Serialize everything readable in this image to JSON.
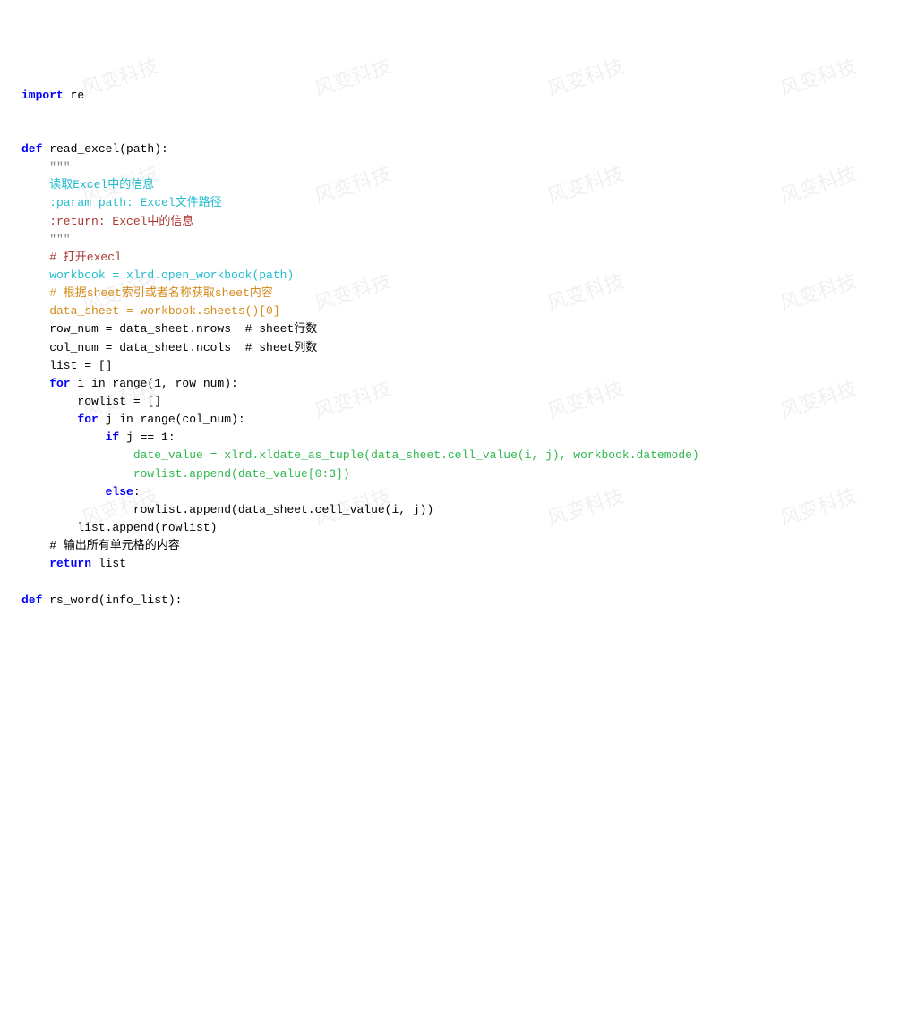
{
  "watermark_text": "风变科技",
  "code": {
    "l01_import": "import",
    "l01_re": " re",
    "l03_def": "def",
    "l03_sig": " read_excel(path):",
    "l04_tq": "    \"\"\"",
    "l05_doc": "    读取Excel中的信息",
    "l06_doc": "    :param path: Excel文件路径",
    "l07_ret": "    :return: Excel中的信息",
    "l08_tq": "    \"\"\"",
    "l09_cmt": "    # 打开execl",
    "l10_wb": "    workbook = xlrd.open_workbook(path)",
    "l11_cmt": "    # 根据sheet索引或者名称获取sheet内容",
    "l12_ds": "    data_sheet = workbook.sheets()[0]",
    "l13_row": "    row_num = data_sheet.nrows  ",
    "l13_cmt": "# sheet行数",
    "l14_col": "    col_num = data_sheet.ncols  ",
    "l14_cmt": "# sheet列数",
    "l15_list": "    list = []",
    "l16_for": "    for",
    "l16_rest": " i in range(1, row_num):",
    "l17_rl": "        rowlist = []",
    "l18_for": "        for",
    "l18_rest": " j in range(col_num):",
    "l19_if": "            if",
    "l19_rest": " j == 1:",
    "l20_dv": "                date_value = xlrd.xldate_as_tuple(data_sheet.cell_value(i, j), workbook.datemode)",
    "l21_ap": "                rowlist.append(date_value[0:3])",
    "l22_else": "            else",
    "l22_colon": ":",
    "l23_ap": "                rowlist.append(data_sheet.cell_value(i, j))",
    "l24_ap": "        list.append(rowlist)",
    "l25_cmt": "    # 输出所有单元格的内容",
    "l26_ret": "    return",
    "l26_rest": " list",
    "l28_def": "def",
    "l28_sig": " rs_word(info_list):"
  }
}
